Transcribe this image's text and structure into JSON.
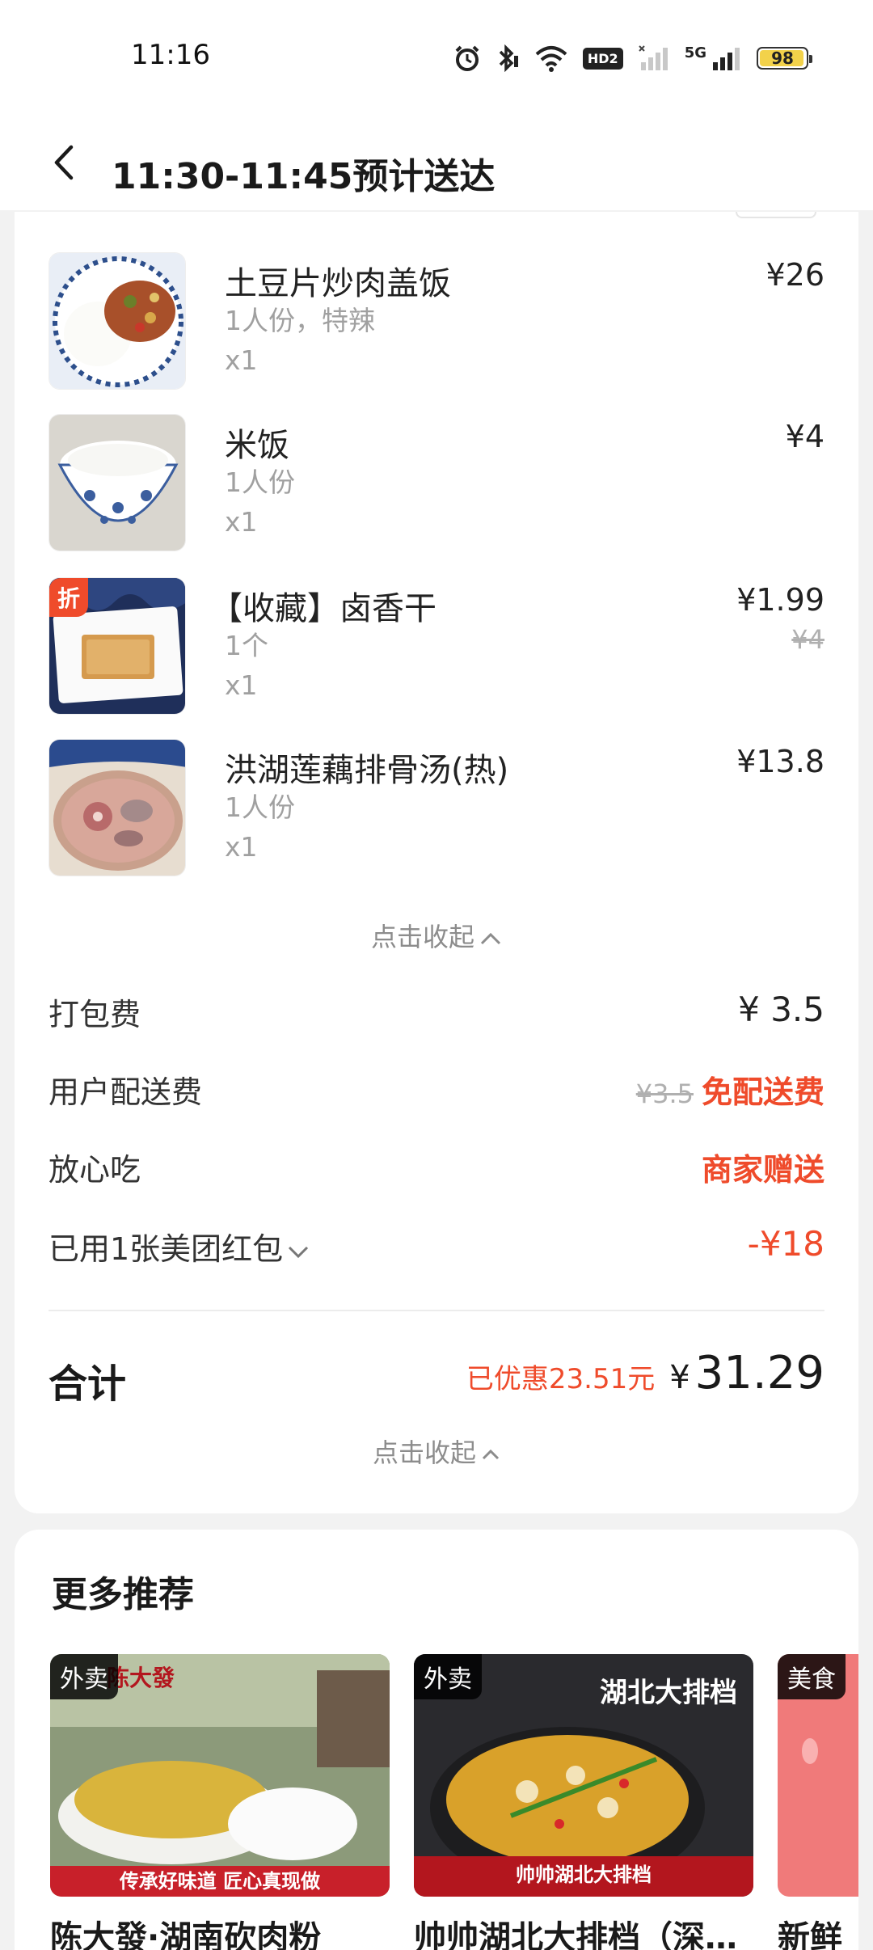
{
  "status_bar": {
    "time": "11:16",
    "battery": "98",
    "hd_label": "HD2",
    "network_label": "5G"
  },
  "header": {
    "title": "11:30-11:45预计送达"
  },
  "order_items": [
    {
      "name": "土豆片炒肉盖饭",
      "spec": "1人份，特辣",
      "qty": "x1",
      "price": "¥26",
      "original_price": "",
      "discount_tag": ""
    },
    {
      "name": "米饭",
      "spec": "1人份",
      "qty": "x1",
      "price": "¥4",
      "original_price": "",
      "discount_tag": ""
    },
    {
      "name": "【收藏】卤香干",
      "spec": "1个",
      "qty": "x1",
      "price": "¥1.99",
      "original_price": "¥4",
      "discount_tag": "折"
    },
    {
      "name": "洪湖莲藕排骨汤(热)",
      "spec": "1人份",
      "qty": "x1",
      "price": "¥13.8",
      "original_price": "",
      "discount_tag": ""
    }
  ],
  "collapse_label": "点击收起",
  "fees": {
    "packing": {
      "label": "打包费",
      "value": "¥ 3.5"
    },
    "delivery": {
      "label": "用户配送费",
      "original": "¥3.5",
      "value": "免配送费"
    },
    "assurance": {
      "label": "放心吃",
      "value": "商家赠送"
    },
    "redpacket": {
      "label": "已用1张美团红包",
      "value": "-¥18"
    }
  },
  "total": {
    "label": "合计",
    "saved": "已优惠23.51元",
    "currency": "¥",
    "amount": "31.29"
  },
  "recommendations": {
    "title": "更多推荐",
    "items": [
      {
        "badge": "外卖",
        "name": "陈大發·湖南砍肉粉",
        "img_title": "陈大發",
        "img_caption": "传承好味道 匠心真现做"
      },
      {
        "badge": "外卖",
        "name": "帅帅湖北大排档（深…",
        "img_title": "湖北大排档",
        "img_caption": "帅帅湖北大排档"
      },
      {
        "badge": "美食",
        "name": "新鲜",
        "img_title": "",
        "img_caption": ""
      }
    ]
  },
  "colors": {
    "accent_red": "#ef4b2b",
    "text_main": "#222222",
    "text_muted": "#a0a0a0"
  }
}
